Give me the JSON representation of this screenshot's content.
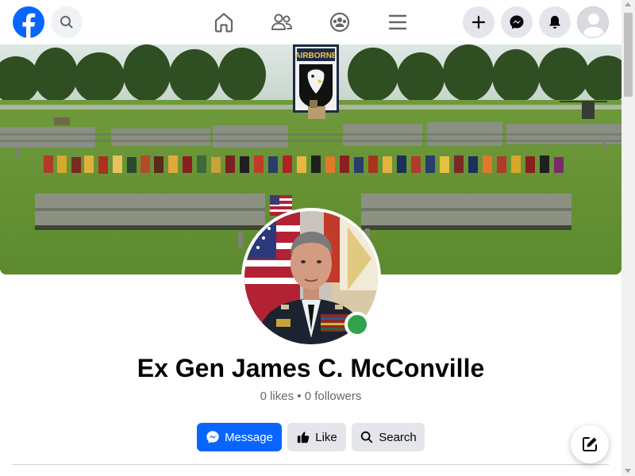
{
  "topbar": {
    "logo_icon": "facebook-logo-icon",
    "search_icon": "search-icon",
    "nav": [
      {
        "name": "home",
        "icon": "home-icon"
      },
      {
        "name": "friends",
        "icon": "friends-icon"
      },
      {
        "name": "groups",
        "icon": "groups-icon"
      },
      {
        "name": "menu",
        "icon": "hamburger-menu-icon"
      }
    ],
    "actions": [
      {
        "name": "create",
        "icon": "plus-icon"
      },
      {
        "name": "messenger",
        "icon": "messenger-icon"
      },
      {
        "name": "notifications",
        "icon": "bell-icon"
      },
      {
        "name": "account",
        "icon": "avatar-icon"
      }
    ]
  },
  "profile": {
    "name": "Ex Gen James C. McConville",
    "stats": "0 likes • 0 followers",
    "online": true
  },
  "cover": {
    "banner_text": "AIRBORNE"
  },
  "buttons": {
    "message": "Message",
    "like": "Like",
    "search": "Search"
  },
  "colors": {
    "brand": "#0866ff",
    "online": "#31a24c",
    "secondary_button": "#e4e6eb",
    "muted_text": "#65676b"
  }
}
